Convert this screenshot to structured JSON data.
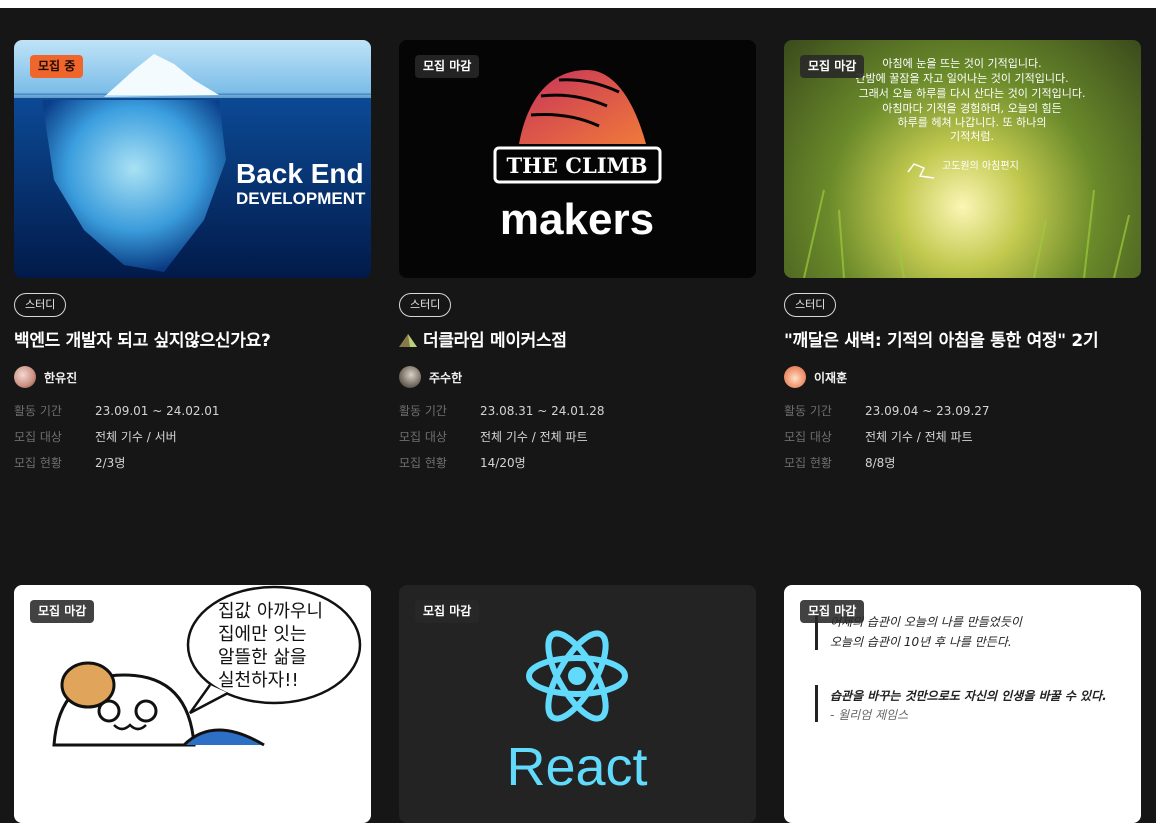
{
  "cards": [
    {
      "badge": "모집 중",
      "thumb_text": {
        "line1": "Back End",
        "line2": "DEVELOPMENT"
      },
      "tag": "스터디",
      "title": "백엔드 개발자 되고 싶지않으신가요?",
      "author": "한유진",
      "period_label": "활동 기간",
      "period": "23.09.01 ~ 24.02.01",
      "target_label": "모집 대상",
      "target": "전체 기수 / 서버",
      "status_label": "모집 현황",
      "status": "2/3명"
    },
    {
      "badge": "모집 마감",
      "thumb_text": {
        "line1": "THE CLIMB",
        "line2": "makers"
      },
      "tag": "스터디",
      "title": "더클라임 메이커스점",
      "author": "주수한",
      "period_label": "활동 기간",
      "period": "23.08.31 ~ 24.01.28",
      "target_label": "모집 대상",
      "target": "전체 기수 / 전체 파트",
      "status_label": "모집 현황",
      "status": "14/20명"
    },
    {
      "badge": "모집 마감",
      "thumb_text": {
        "lines": [
          "아침에 눈을 뜨는 것이 기적입니다.",
          "간밤에 꿀잠을 자고 일어나는 것이 기적입니다.",
          "그래서 오늘 하루를 다시 산다는 것이 기적입니다.",
          "아침마다 기적을 경험하며, 오늘의 힘든",
          "하루를 헤쳐 나갑니다. 또 하나의",
          "기적처럼."
        ],
        "signature": "고도원의 아침편지"
      },
      "tag": "스터디",
      "title": "\"깨달은 새벽: 기적의 아침을 통한 여정\" 2기",
      "author": "이재훈",
      "period_label": "활동 기간",
      "period": "23.09.04 ~ 23.09.27",
      "target_label": "모집 대상",
      "target": "전체 기수 / 전체 파트",
      "status_label": "모집 현황",
      "status": "8/8명"
    },
    {
      "badge": "모집 마감",
      "thumb_text": {
        "lines": [
          "집값 아까우니",
          "집에만 잇는",
          "알뜰한 삶을",
          "실천하자!!"
        ]
      }
    },
    {
      "badge": "모집 마감",
      "thumb_text": {
        "word": "React"
      }
    },
    {
      "badge": "모집 마감",
      "thumb_text": {
        "q1a": "어제의 습관이 오늘의 나를 만들었듯이",
        "q1b": "오늘의 습관이 10년 후 나를 만든다.",
        "q2a": "습관을 바꾸는 것만으로도 자신의 인생을 바꿀 수 있다.",
        "q2b": "- 윌리엄 제임스"
      }
    }
  ],
  "colors": {
    "background": "#161616",
    "open_badge": "#f0652b",
    "closed_badge": "#282828"
  },
  "icons": [
    "mountain-icon"
  ]
}
